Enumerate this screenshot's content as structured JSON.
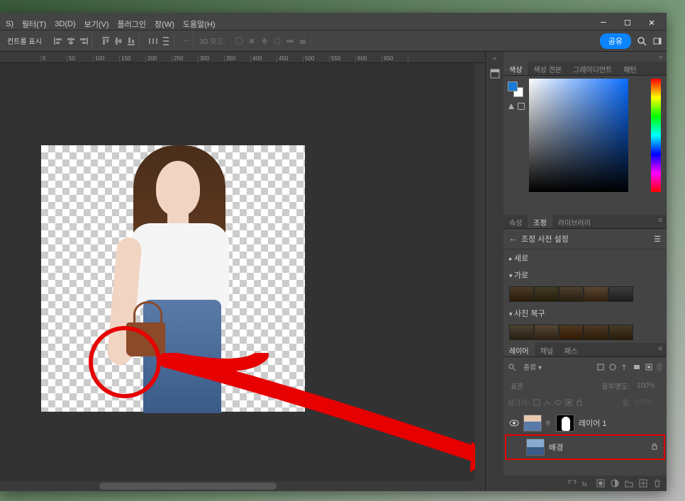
{
  "menu": {
    "items": [
      "S)",
      "필터(T)",
      "3D(D)",
      "보기(V)",
      "플러그인",
      "창(W)",
      "도움말(H)"
    ]
  },
  "options_left_label": "컨트롤 표시",
  "options_mid": "3D 모드:",
  "share": "공유",
  "color_tabs": [
    "색상",
    "색상 견본",
    "그레이디언트",
    "패턴"
  ],
  "adj_tabs": [
    "속성",
    "조정",
    "라이브러리"
  ],
  "adj_header": "조정 사전 설정",
  "adj_sec1": "세로",
  "adj_sec2": "가로",
  "adj_sec3": "사진 복구",
  "layers_tabs": [
    "레이어",
    "채널",
    "패스"
  ],
  "filter_label": "종류",
  "blend_mode": "표준",
  "opacity_label": "불투명도:",
  "opacity_val": "100%",
  "lock_label": "잠그기:",
  "fill_label": "칠:",
  "fill_val": "100%",
  "layer1": "레이어 1",
  "layer_bg": "배경",
  "ruler_ticks": [
    "0",
    "50",
    "100",
    "150",
    "200",
    "250",
    "300",
    "350",
    "400",
    "450",
    "500",
    "550",
    "600",
    "650"
  ]
}
